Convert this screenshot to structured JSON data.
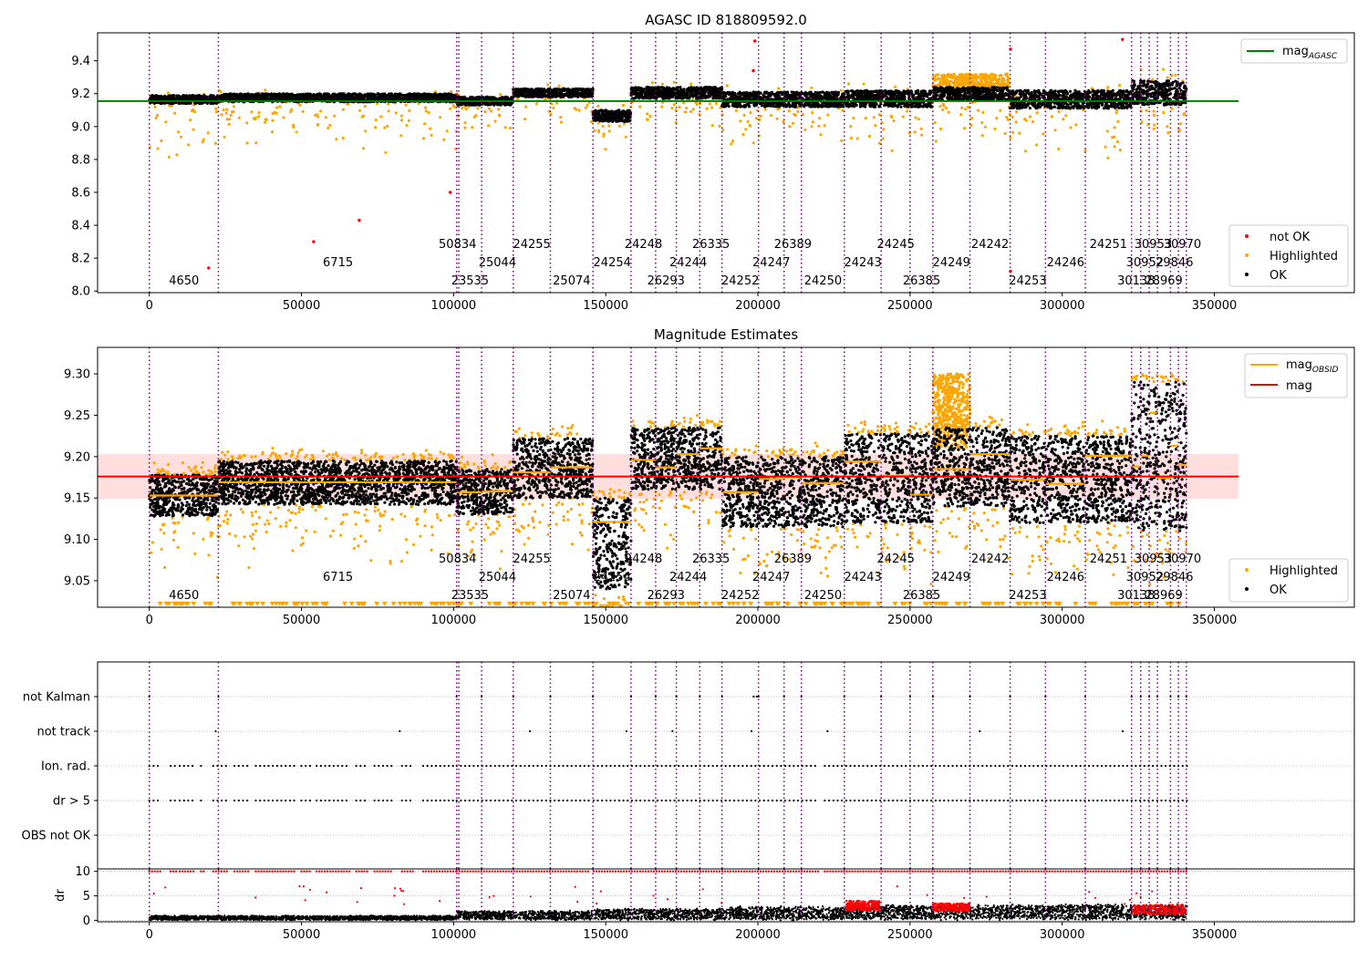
{
  "chart_data": [
    {
      "type": "scatter",
      "title": "AGASC ID 818809592.0",
      "xlabel": "",
      "ylabel": "",
      "xlim": [
        -17000,
        396000
      ],
      "ylim": [
        7.99,
        9.57
      ],
      "x_ticks": [
        0,
        50000,
        100000,
        150000,
        200000,
        250000,
        300000,
        350000
      ],
      "y_ticks": [
        "8.0",
        "8.2",
        "8.4",
        "8.6",
        "8.8",
        "9.0",
        "9.2",
        "9.4"
      ],
      "grid": false,
      "legend_upper": {
        "position": "upper-right",
        "entries": [
          "mag_AGASC"
        ]
      },
      "legend_lower": {
        "position": "lower-right",
        "entries": [
          "not OK",
          "Highlighted",
          "OK"
        ]
      },
      "mag_agasc": 9.155,
      "mag_agasc_x_end": 358000,
      "obsid_boundaries": [
        0,
        22700,
        101000,
        101700,
        109200,
        119600,
        131800,
        145800,
        158300,
        166400,
        173200,
        180900,
        188200,
        200200,
        208600,
        214300,
        228400,
        240500,
        250000,
        257500,
        269700,
        282900,
        294500,
        307600,
        322800,
        325800,
        328600,
        331300,
        335600,
        338200,
        340800
      ],
      "obsid_labels": [
        {
          "text": "4650",
          "x": 11400,
          "row": 3
        },
        {
          "text": "6715",
          "x": 62000,
          "row": 2
        },
        {
          "text": "50834",
          "x": 101300,
          "row": 1
        },
        {
          "text": "23535",
          "x": 105400,
          "row": 3
        },
        {
          "text": "25044",
          "x": 114400,
          "row": 2
        },
        {
          "text": "24255",
          "x": 125700,
          "row": 1
        },
        {
          "text": "25074",
          "x": 138800,
          "row": 3
        },
        {
          "text": "24254",
          "x": 152100,
          "row": 2
        },
        {
          "text": "24248",
          "x": 162400,
          "row": 1
        },
        {
          "text": "26293",
          "x": 169800,
          "row": 3
        },
        {
          "text": "24244",
          "x": 177100,
          "row": 2
        },
        {
          "text": "26335",
          "x": 184600,
          "row": 1
        },
        {
          "text": "24252",
          "x": 194200,
          "row": 3
        },
        {
          "text": "24247",
          "x": 204400,
          "row": 2
        },
        {
          "text": "26389",
          "x": 211500,
          "row": 1
        },
        {
          "text": "24250",
          "x": 221400,
          "row": 3
        },
        {
          "text": "24243",
          "x": 234500,
          "row": 2
        },
        {
          "text": "24245",
          "x": 245300,
          "row": 1
        },
        {
          "text": "26385",
          "x": 253800,
          "row": 3
        },
        {
          "text": "24249",
          "x": 263600,
          "row": 2
        },
        {
          "text": "24242",
          "x": 276300,
          "row": 1
        },
        {
          "text": "24253",
          "x": 288700,
          "row": 3
        },
        {
          "text": "24246",
          "x": 301100,
          "row": 2
        },
        {
          "text": "24251",
          "x": 315200,
          "row": 1
        },
        {
          "text": "30138",
          "x": 324300,
          "row": 3
        },
        {
          "text": "30952",
          "x": 327200,
          "row": 2
        },
        {
          "text": "30953",
          "x": 329900,
          "row": 1
        },
        {
          "text": "28969",
          "x": 333400,
          "row": 3
        },
        {
          "text": "29846",
          "x": 336900,
          "row": 2
        },
        {
          "text": "30970",
          "x": 339500,
          "row": 1
        }
      ],
      "segments": [
        {
          "x0": 0,
          "x1": 22700,
          "ok_y": [
            9.14,
            9.19
          ],
          "scatter": 0.35
        },
        {
          "x0": 22700,
          "x1": 101000,
          "ok_y": [
            9.15,
            9.2
          ],
          "scatter": 0.25
        },
        {
          "x0": 101000,
          "x1": 119600,
          "ok_y": [
            9.13,
            9.18
          ],
          "scatter": 0.2
        },
        {
          "x0": 119600,
          "x1": 145800,
          "ok_y": [
            9.18,
            9.23
          ],
          "scatter": 0.15
        },
        {
          "x0": 145800,
          "x1": 158300,
          "ok_y": [
            9.03,
            9.1
          ],
          "scatter": 0.15
        },
        {
          "x0": 158300,
          "x1": 188200,
          "ok_y": [
            9.17,
            9.24
          ],
          "scatter": 0.2
        },
        {
          "x0": 188200,
          "x1": 228400,
          "ok_y": [
            9.12,
            9.21
          ],
          "scatter": 0.25
        },
        {
          "x0": 228400,
          "x1": 257500,
          "ok_y": [
            9.12,
            9.22
          ],
          "scatter": 0.3
        },
        {
          "x0": 257500,
          "x1": 282900,
          "ok_y": [
            9.16,
            9.24
          ],
          "scatter": 0.2
        },
        {
          "x0": 282900,
          "x1": 322800,
          "ok_y": [
            9.11,
            9.22
          ],
          "scatter": 0.25
        },
        {
          "x0": 322800,
          "x1": 340800,
          "ok_y": [
            9.13,
            9.28
          ],
          "scatter": 0.2
        }
      ],
      "series_colors": {
        "ok": "#000000",
        "highlighted": "#ffa500",
        "not_ok": "#ff0000",
        "mag_agasc": "#008000",
        "obsid_line": "#800080"
      }
    },
    {
      "type": "scatter",
      "title": "Magnitude Estimates",
      "xlabel": "",
      "ylabel": "",
      "xlim": [
        -17000,
        396000
      ],
      "ylim": [
        9.018,
        9.332
      ],
      "x_ticks": [
        0,
        50000,
        100000,
        150000,
        200000,
        250000,
        300000,
        350000
      ],
      "y_ticks": [
        "9.05",
        "9.10",
        "9.15",
        "9.20",
        "9.25",
        "9.30"
      ],
      "grid": false,
      "legend_upper": {
        "position": "upper-right",
        "entries": [
          "mag_OBSID",
          "mag"
        ]
      },
      "legend_lower": {
        "position": "lower-right",
        "entries": [
          "Highlighted",
          "OK"
        ]
      },
      "mag": 9.176,
      "mag_band": [
        9.149,
        9.203
      ],
      "mag_x_end": 358000,
      "obsid_mags": [
        {
          "x0": 0,
          "x1": 22700,
          "mag": 9.153
        },
        {
          "x0": 22700,
          "x1": 101000,
          "mag": 9.169
        },
        {
          "x0": 101000,
          "x1": 109200,
          "mag": 9.157
        },
        {
          "x0": 109200,
          "x1": 119600,
          "mag": 9.158
        },
        {
          "x0": 119600,
          "x1": 131800,
          "mag": 9.181
        },
        {
          "x0": 131800,
          "x1": 145800,
          "mag": 9.187
        },
        {
          "x0": 145800,
          "x1": 158300,
          "mag": 9.121
        },
        {
          "x0": 158300,
          "x1": 166400,
          "mag": 9.196
        },
        {
          "x0": 166400,
          "x1": 173200,
          "mag": 9.187
        },
        {
          "x0": 173200,
          "x1": 180900,
          "mag": 9.203
        },
        {
          "x0": 180900,
          "x1": 188200,
          "mag": 9.21
        },
        {
          "x0": 188200,
          "x1": 200200,
          "mag": 9.157
        },
        {
          "x0": 200200,
          "x1": 208600,
          "mag": 9.173
        },
        {
          "x0": 208600,
          "x1": 214300,
          "mag": 9.175
        },
        {
          "x0": 214300,
          "x1": 228400,
          "mag": 9.168
        },
        {
          "x0": 228400,
          "x1": 240500,
          "mag": 9.194
        },
        {
          "x0": 240500,
          "x1": 250000,
          "mag": 9.177
        },
        {
          "x0": 250000,
          "x1": 257500,
          "mag": 9.154
        },
        {
          "x0": 257500,
          "x1": 269700,
          "mag": 9.185
        },
        {
          "x0": 269700,
          "x1": 282900,
          "mag": 9.203
        },
        {
          "x0": 282900,
          "x1": 294500,
          "mag": 9.172
        },
        {
          "x0": 294500,
          "x1": 307600,
          "mag": 9.167
        },
        {
          "x0": 307600,
          "x1": 322800,
          "mag": 9.201
        },
        {
          "x0": 322800,
          "x1": 325800,
          "mag": 9.188
        },
        {
          "x0": 325800,
          "x1": 328600,
          "mag": 9.201
        },
        {
          "x0": 328600,
          "x1": 331300,
          "mag": 9.253
        },
        {
          "x0": 331300,
          "x1": 335600,
          "mag": 9.174
        },
        {
          "x0": 335600,
          "x1": 338200,
          "mag": 9.213
        },
        {
          "x0": 338200,
          "x1": 340800,
          "mag": 9.19
        }
      ],
      "segments": [
        {
          "x0": 0,
          "x1": 22700,
          "ok_y": [
            9.128,
            9.178
          ]
        },
        {
          "x0": 22700,
          "x1": 101000,
          "ok_y": [
            9.142,
            9.195
          ]
        },
        {
          "x0": 101000,
          "x1": 119600,
          "ok_y": [
            9.13,
            9.185
          ]
        },
        {
          "x0": 119600,
          "x1": 145800,
          "ok_y": [
            9.15,
            9.222
          ]
        },
        {
          "x0": 145800,
          "x1": 158300,
          "ok_y": [
            9.04,
            9.15
          ]
        },
        {
          "x0": 158300,
          "x1": 188200,
          "ok_y": [
            9.16,
            9.235
          ]
        },
        {
          "x0": 188200,
          "x1": 228400,
          "ok_y": [
            9.115,
            9.2
          ]
        },
        {
          "x0": 228400,
          "x1": 257500,
          "ok_y": [
            9.12,
            9.228
          ]
        },
        {
          "x0": 257500,
          "x1": 282900,
          "ok_y": [
            9.14,
            9.235
          ]
        },
        {
          "x0": 282900,
          "x1": 322800,
          "ok_y": [
            9.12,
            9.225
          ]
        },
        {
          "x0": 322800,
          "x1": 340800,
          "ok_y": [
            9.11,
            9.29
          ]
        }
      ],
      "series_colors": {
        "ok": "#000000",
        "highlighted": "#ffa500",
        "mag_obsid": "#ffa500",
        "mag": "#ff0000",
        "mag_band": "#ff0000"
      }
    },
    {
      "type": "scatter",
      "title": "",
      "xlabel": "",
      "ylabel": "",
      "xlim": [
        -17000,
        396000
      ],
      "categories": [
        "not Kalman",
        "not track",
        "Ion. rad.",
        "dr > 5",
        "OBS not OK"
      ],
      "grid": true,
      "flag_spans": {
        "not Kalman": [
          [
            0,
            500
          ],
          [
            22700,
            23400
          ],
          [
            101000,
            101700
          ],
          [
            109200,
            109600
          ],
          [
            119600,
            120000
          ],
          [
            131800,
            132200
          ],
          [
            145800,
            146200
          ],
          [
            158300,
            158700
          ],
          [
            166400,
            166800
          ],
          [
            173200,
            173600
          ],
          [
            180900,
            181300
          ],
          [
            188200,
            188600
          ],
          [
            198600,
            199000
          ],
          [
            199600,
            200000
          ],
          [
            200200,
            200600
          ],
          [
            208600,
            209000
          ],
          [
            214300,
            214700
          ],
          [
            228400,
            228800
          ],
          [
            240500,
            240900
          ],
          [
            250000,
            250400
          ],
          [
            257500,
            257900
          ],
          [
            269700,
            270100
          ],
          [
            282900,
            283300
          ],
          [
            294500,
            294900
          ],
          [
            307600,
            308000
          ],
          [
            322800,
            323200
          ],
          [
            325800,
            326200
          ],
          [
            328600,
            329000
          ],
          [
            331300,
            331700
          ],
          [
            335600,
            336000
          ],
          [
            338200,
            338600
          ],
          [
            340800,
            341200
          ]
        ],
        "not track": [
          [
            21800,
            22300
          ],
          [
            82300,
            82700
          ],
          [
            125100,
            125500
          ],
          [
            156800,
            157200
          ],
          [
            171900,
            172300
          ],
          [
            197900,
            198900
          ],
          [
            222900,
            223300
          ],
          [
            272900,
            273300
          ],
          [
            319900,
            320300
          ]
        ],
        "Ion. rad.": [
          [
            0,
            4000
          ],
          [
            7000,
            9000
          ],
          [
            10000,
            15000
          ],
          [
            17000,
            18000
          ],
          [
            21000,
            26000
          ],
          [
            28000,
            33000
          ],
          [
            35000,
            48000
          ],
          [
            50000,
            53000
          ],
          [
            55000,
            66000
          ],
          [
            68000,
            72000
          ],
          [
            74000,
            80000
          ],
          [
            83000,
            87000
          ],
          [
            90000,
            101000
          ],
          [
            101000,
            145000
          ],
          [
            146000,
            220000
          ],
          [
            222000,
            341000
          ]
        ],
        "dr > 5": [
          [
            0,
            4000
          ],
          [
            7000,
            9000
          ],
          [
            10000,
            15000
          ],
          [
            17000,
            18000
          ],
          [
            21000,
            26000
          ],
          [
            28000,
            33000
          ],
          [
            35000,
            48000
          ],
          [
            50000,
            53000
          ],
          [
            55000,
            66000
          ],
          [
            68000,
            72000
          ],
          [
            74000,
            80000
          ],
          [
            83000,
            87000
          ],
          [
            90000,
            101000
          ],
          [
            101000,
            145000
          ],
          [
            146000,
            220000
          ],
          [
            222000,
            341000
          ]
        ],
        "OBS not OK": []
      },
      "series_colors": {
        "flag": "#000000",
        "grid": "#b0b0b0"
      }
    },
    {
      "type": "scatter",
      "title": "",
      "xlabel": "",
      "ylabel": "dr",
      "xlim": [
        -17000,
        396000
      ],
      "ylim": [
        -0.3,
        10.5
      ],
      "x_ticks": [
        0,
        50000,
        100000,
        150000,
        200000,
        250000,
        300000,
        350000
      ],
      "y_ticks": [
        "0",
        "5",
        "10"
      ],
      "grid": true,
      "capped_value": 10,
      "segments": [
        {
          "x0": 0,
          "x1": 101000,
          "dr": [
            0.2,
            0.8
          ]
        },
        {
          "x0": 101000,
          "x1": 145800,
          "dr": [
            0.4,
            1.6
          ]
        },
        {
          "x0": 145800,
          "x1": 188200,
          "dr": [
            0.5,
            2.0
          ]
        },
        {
          "x0": 188200,
          "x1": 228400,
          "dr": [
            0.6,
            2.3
          ]
        },
        {
          "x0": 228400,
          "x1": 282900,
          "dr": [
            0.6,
            2.6
          ]
        },
        {
          "x0": 282900,
          "x1": 341000,
          "dr": [
            0.6,
            2.8
          ]
        }
      ],
      "red_clusters": [
        [
          229000,
          240000,
          2.0,
          4.0
        ],
        [
          257500,
          269700,
          1.8,
          3.5
        ],
        [
          322800,
          340800,
          1.2,
          3.2
        ]
      ],
      "series_colors": {
        "ok": "#000000",
        "flagged": "#ff0000"
      }
    }
  ]
}
